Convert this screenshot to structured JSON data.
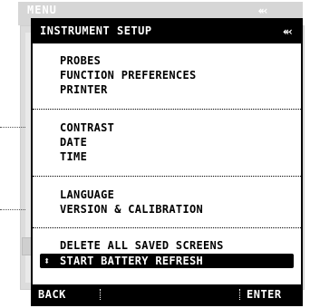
{
  "background_window": {
    "title": "MENU",
    "power_icon": "plug-icon"
  },
  "dialog": {
    "title": "INSTRUMENT SETUP",
    "power_icon": "plug-icon",
    "groups": [
      {
        "items": [
          "PROBES",
          "FUNCTION PREFERENCES",
          "PRINTER"
        ]
      },
      {
        "items": [
          "CONTRAST",
          "DATE",
          "TIME"
        ]
      },
      {
        "items": [
          "LANGUAGE",
          "VERSION & CALIBRATION"
        ]
      },
      {
        "items": [
          "DELETE ALL SAVED SCREENS"
        ]
      }
    ],
    "selected_item": "START BATTERY REFRESH",
    "selected_icon": "up-down-arrow-icon"
  },
  "softkeys": {
    "f1": "BACK",
    "f2": "",
    "f3": "",
    "f4": "ENTER"
  }
}
